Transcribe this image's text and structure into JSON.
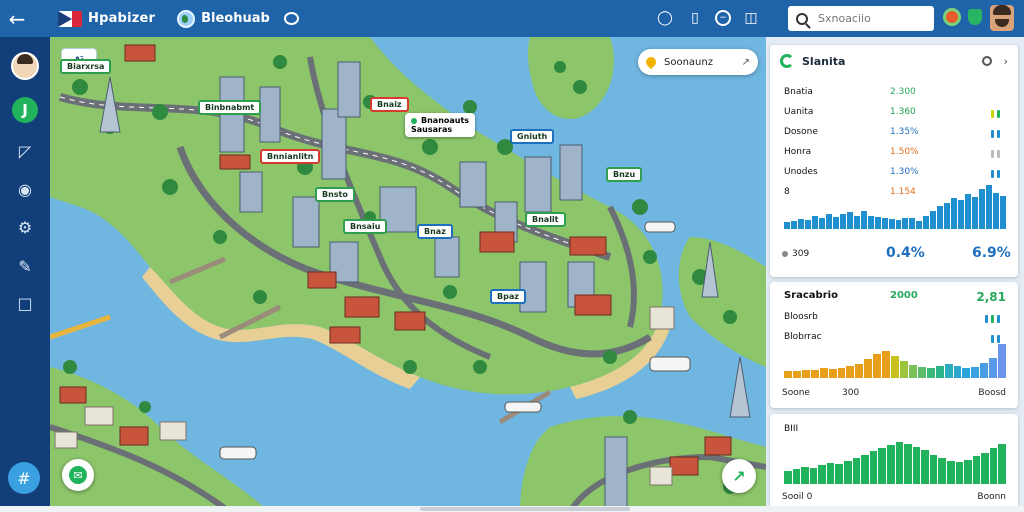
{
  "header": {
    "app_name": "Hpabizer",
    "tab_name": "Bleohuab",
    "search_placeholder": "Sxnoaciio"
  },
  "map": {
    "logo_text": "Aᴉ̃",
    "search_chip": "Soonaunz",
    "labels": [
      {
        "text": "Binbnabmt",
        "color": "green"
      },
      {
        "text": "Biarxrsa",
        "color": "green"
      },
      {
        "text": "Bnaiz",
        "color": "red"
      },
      {
        "text": "Bnnianlitn",
        "color": "red"
      },
      {
        "text": "Gniuth",
        "color": "blue"
      },
      {
        "text": "Bnsto",
        "color": "green"
      },
      {
        "text": "Bnsaiu",
        "color": "green"
      },
      {
        "text": "Bnaz",
        "color": "blue"
      },
      {
        "text": "Bnalit",
        "color": "green"
      },
      {
        "text": "Bnzu",
        "color": "green"
      },
      {
        "text": "Bpaz",
        "color": "blue"
      }
    ],
    "callout": "Bnanoauts\nSausaras"
  },
  "panel": {
    "card1": {
      "title": "Slanita",
      "metrics": [
        {
          "name": "Bnatia",
          "value": "2.300",
          "color": "#2aa860"
        },
        {
          "name": "Uanita",
          "value": "1.360",
          "color": "#1f9e4f"
        },
        {
          "name": "Dosone",
          "value": "1.35%",
          "color": "#1f6fbf"
        },
        {
          "name": "Honra",
          "value": "1.50%",
          "color": "#e0701c"
        },
        {
          "name": "Unodes",
          "value": "1.30%",
          "color": "#1f6fbf"
        },
        {
          "name": "8",
          "value": "1.154",
          "color": "#e0701c"
        }
      ],
      "foot_label": "309",
      "foot_num1": "0.4%",
      "foot_num2": "6.9%"
    },
    "card2": {
      "title": "Sracabrio",
      "value": "2000",
      "value2": "2,81",
      "row2": "Bloosrb",
      "row3": "Blobrrac",
      "foot_left": "Soone",
      "foot_mid": "300",
      "foot_right": "Boosd"
    },
    "card3": {
      "title": "BIII",
      "foot_left": "Sooil 0",
      "foot_right": "Boonn"
    }
  },
  "colors": {
    "header": "#1f63a8",
    "sidebar": "#123e7a",
    "water": "#6fb6e0",
    "land": "#8cc56a",
    "accent_green": "#21b35b"
  }
}
